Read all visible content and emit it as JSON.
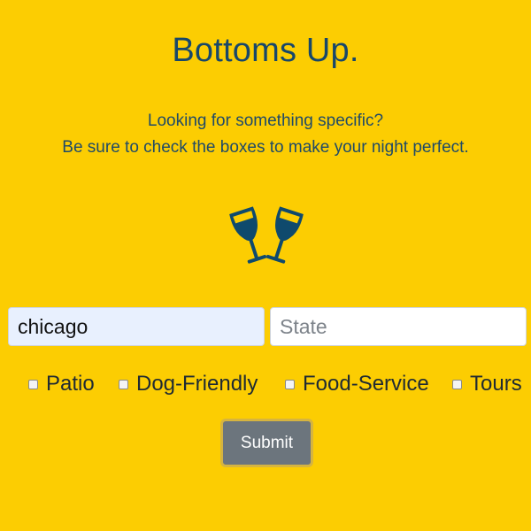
{
  "page": {
    "title": "Bottoms Up.",
    "subtitle_line1": "Looking for something specific?",
    "subtitle_line2": "Be sure to check the boxes to make your night perfect.",
    "icon": "glass-cheers-icon",
    "background_color": "#fccd02",
    "text_color": "#18476a"
  },
  "form": {
    "city": {
      "value": "chicago",
      "placeholder": ""
    },
    "state": {
      "value": "",
      "placeholder": "State"
    },
    "options": [
      {
        "label": "Patio",
        "checked": false
      },
      {
        "label": "Dog-Friendly",
        "checked": false
      },
      {
        "label": "Food-Service",
        "checked": false
      },
      {
        "label": "Tours",
        "checked": false
      }
    ],
    "submit_label": "Submit",
    "submit_color": "#6c757d"
  }
}
